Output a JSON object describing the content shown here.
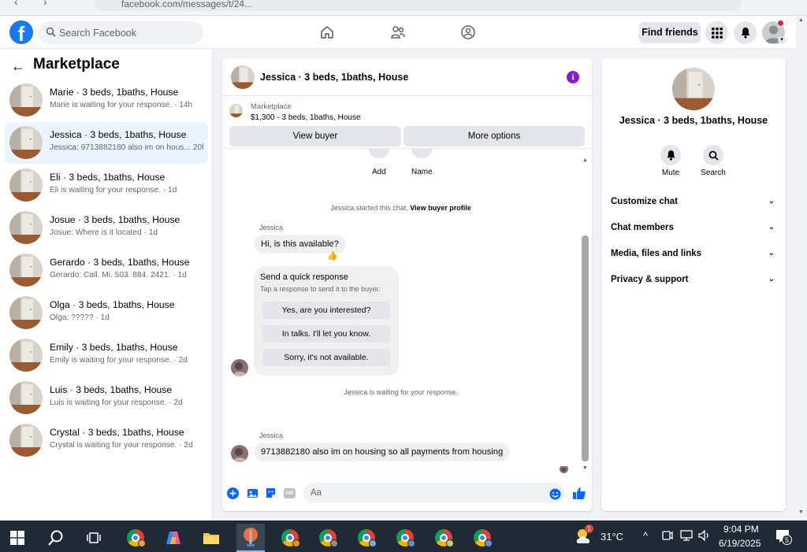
{
  "browser": {
    "url": "facebook.com/messages/t/24..."
  },
  "header": {
    "logo": "f",
    "search_placeholder": "Search Facebook",
    "find_friends": "Find friends"
  },
  "sidebar": {
    "title": "Marketplace",
    "conversations": [
      {
        "name": "Marie · 3 beds, 1baths, House",
        "preview": "Marie is waiting for your response. · 14h"
      },
      {
        "name": "Jessica · 3 beds, 1baths, House",
        "preview": "Jessica: 9713882180 also im on hous...  20h"
      },
      {
        "name": "Eli · 3 beds, 1baths, House",
        "preview": "Eli is waiting for your response. · 1d"
      },
      {
        "name": "Josue · 3 beds, 1baths, House",
        "preview": "Josue: Where is it located · 1d"
      },
      {
        "name": "Gerardo · 3 beds, 1baths, House",
        "preview": "Gerardo: Call. Mi. 503. 884. 2421. · 1d"
      },
      {
        "name": "Olga · 3 beds, 1baths, House",
        "preview": "Olga: ????? · 1d"
      },
      {
        "name": "Emily · 3 beds, 1baths, House",
        "preview": "Emily is waiting for your response. · 2d"
      },
      {
        "name": "Luis · 3 beds, 1baths, House",
        "preview": "Luis is waiting for your response. · 2d"
      },
      {
        "name": "Crystal · 3 beds, 1baths, House",
        "preview": "Crystal is waiting for your response. · 2d"
      }
    ]
  },
  "chat": {
    "title": "Jessica · 3 beds, 1baths, House",
    "listing": {
      "label": "Marketplace",
      "price_title": "$1,300 - 3 beds, 1baths, House"
    },
    "buttons": {
      "view_buyer": "View buyer",
      "more_options": "More options"
    },
    "top_actions": {
      "add": "Add",
      "name": "Name"
    },
    "started_text": "Jessica started this chat.",
    "view_profile_link": "View buyer profile",
    "sender_name": "Jessica",
    "first_message": "Hi, is this available?",
    "reaction": "👍",
    "quick_response": {
      "title": "Send a quick response",
      "subtitle": "Tap a response to send it to the buyer.",
      "options": [
        "Yes, are you interested?",
        "In talks. I'll let you know.",
        "Sorry, it's not available."
      ]
    },
    "waiting_text": "Jessica is waiting for your response.",
    "second_sender": "Jessica",
    "second_message": "9713882180 also im on housing so all payments from  housing",
    "composer_placeholder": "Aa",
    "gif_label": "GIF"
  },
  "right_panel": {
    "title": "Jessica · 3 beds, 1baths, House",
    "mute": "Mute",
    "search": "Search",
    "sections": [
      "Customize chat",
      "Chat members",
      "Media, files and links",
      "Privacy & support"
    ]
  },
  "taskbar": {
    "weather_badge": "1",
    "temperature": "31°C",
    "time": "9:04 PM",
    "date": "6/19/2025",
    "notification_count": "5"
  },
  "colors": {
    "brand": "#1877f2",
    "active_conversation": "#ebf5ff",
    "info_icon": "#8a19d6"
  }
}
